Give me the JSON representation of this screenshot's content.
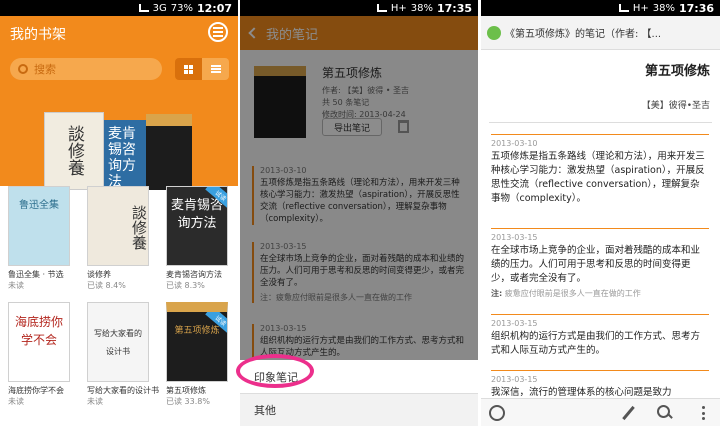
{
  "status_bars": [
    {
      "network": "3G",
      "battery": "73%",
      "time": "12:07"
    },
    {
      "network": "H+",
      "battery": "38%",
      "time": "17:35"
    },
    {
      "network": "H+",
      "battery": "38%",
      "time": "17:36"
    }
  ],
  "shelf": {
    "title": "我的书架",
    "search_placeholder": "搜索",
    "featured_cover_text": "談修養",
    "featured2_cover_text": "麦肯锡咨询方法",
    "books": [
      {
        "title": "鲁迅全集 · 节选",
        "progress": "未读",
        "cover_text": "鲁迅全集",
        "cover_color": "#bfe0ec"
      },
      {
        "title": "谈修养",
        "progress": "已读 8.4%",
        "cover_text": "談修養",
        "cover_color": "#efe9dd"
      },
      {
        "title": "麦肯锡咨询方法",
        "progress": "已读 8.3%",
        "cover_text": "麦肯锡咨询方法",
        "cover_color": "#2b2b2b",
        "badge": "试读"
      },
      {
        "title": "海底捞你学不会",
        "progress": "未读",
        "cover_text": "海底捞你学不会",
        "cover_color": "#ffffff"
      },
      {
        "title": "写给大家看的设计书",
        "progress": "未读",
        "cover_text": "写给大家看的设计书",
        "cover_color": "#f5f5f5"
      },
      {
        "title": "第五项修炼",
        "progress": "已读 33.8%",
        "cover_text": "第五项修炼",
        "cover_color": "#1d1d1d",
        "badge": "试读"
      }
    ]
  },
  "notebook": {
    "header_title": "我的笔记",
    "book_title": "第五项修炼",
    "author_line": "作者: 【美】彼得 • 圣吉",
    "count_line": "共 50 条笔记",
    "modified_line": "修改时间: 2013-04-24",
    "export_label": "导出笔记",
    "notes": [
      {
        "date": "2013-03-10",
        "text": "五项修炼是指五条路线（理论和方法），用来开发三种核心学习能力：激发热望（aspiration），开展反思性交流（reflective conversation），理解复杂事物（complexity）。"
      },
      {
        "date": "2013-03-15",
        "text": "在全球市场上竞争的企业，面对着残酷的成本和业绩的压力。人们可用于思考和反思的时间变得更少，或者完全没有了。",
        "remark_label": "注：",
        "remark": "疲惫应付眼前是很多人一直在做的工作"
      },
      {
        "date": "2013-03-15",
        "text": "组织机构的运行方式是由我们的工作方式、思考方式和人际互动方式产生的。"
      }
    ],
    "popup": [
      "印象笔记",
      "其他"
    ]
  },
  "evernote": {
    "header_title": "《第五项修炼》的笔记（作者: 【...",
    "title": "第五项修炼",
    "author": "【美】彼得•圣吉",
    "notes": [
      {
        "date": "2013-03-10",
        "text": "五项修炼是指五条路线（理论和方法），用来开发三种核心学习能力：激发热望（aspiration），开展反思性交流（reflective conversation），理解复杂事物（complexity）。"
      },
      {
        "date": "2013-03-15",
        "text": "在全球市场上竞争的企业，面对着残酷的成本和业绩的压力。人们可用于思考和反思的时间变得更少，或者完全没有了。",
        "remark_label": "注:",
        "remark": "疲惫应付眼前是很多人一直在做的工作"
      },
      {
        "date": "2013-03-15",
        "text": "组织机构的运行方式是由我们的工作方式、思考方式和人际互动方式产生的。"
      },
      {
        "date": "2013-03-15",
        "text": "我深信，流行的管理体系的核心问题是致力"
      }
    ]
  },
  "colors": {
    "accent": "#f28a1c",
    "highlight": "#ec2f8c"
  }
}
